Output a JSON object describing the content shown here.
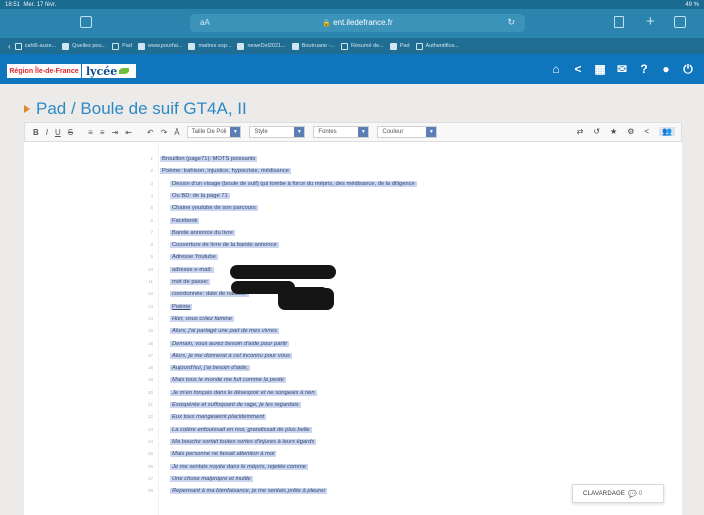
{
  "statusbar": {
    "time": "18:51",
    "date": "Mer. 17 févr.",
    "battery": "49 %"
  },
  "browser": {
    "aa": "aA",
    "url": "ent.iledefrance.fr",
    "tabs": [
      {
        "label": "cahl6-auze...",
        "filled": false
      },
      {
        "label": "Quelles pou...",
        "filled": true
      },
      {
        "label": "Pad",
        "filled": false
      },
      {
        "label": "www.pourfai...",
        "filled": true
      },
      {
        "label": "maitres esp...",
        "filled": true
      },
      {
        "label": "neweDel2021...",
        "filled": true
      },
      {
        "label": "Boutruane -...",
        "filled": true
      },
      {
        "label": "Résumé de...",
        "filled": false
      },
      {
        "label": "Pad",
        "filled": true
      },
      {
        "label": "Authentifica...",
        "filled": false
      }
    ]
  },
  "header": {
    "region_logo": "Région Île-de-France",
    "lycee_logo": "lycée",
    "icons": [
      "home-icon",
      "share-icon",
      "apps-grid-icon",
      "messages-icon",
      "help-icon",
      "user-icon",
      "power-icon"
    ]
  },
  "page": {
    "title": "Pad / Boule de suif GT4A, II"
  },
  "toolbar": {
    "bold": "B",
    "italic": "I",
    "underline": "U",
    "strike": "S",
    "list_ol": "≡",
    "list_ul": "≡",
    "indent": "⇥",
    "outdent": "⇤",
    "undo": "↶",
    "redo": "↷",
    "clear": "Ā",
    "font_size": "Taille De Poli",
    "style": "Style",
    "fonts": "Fontes",
    "color": "Couleur"
  },
  "editor": {
    "lines": [
      {
        "n": "1",
        "text": "Brouillon (page71): MOTS poissants",
        "style": ""
      },
      {
        "n": "2",
        "text": "Poème: trahison, injustice, hypocrisie, médisance",
        "style": ""
      },
      {
        "n": "3",
        "text": "Dessin d'un visage (boule de suif) qui tombe à force du mépris, des médisance, de la diligence",
        "style": ""
      },
      {
        "n": "4",
        "text": "Ou BD: de la page 71",
        "style": ""
      },
      {
        "n": "5",
        "text": "Chaine youtube de son parcours",
        "style": ""
      },
      {
        "n": "6",
        "text": "Facebook",
        "style": ""
      },
      {
        "n": "7",
        "text": "Bande annonce du livre",
        "style": ""
      },
      {
        "n": "8",
        "text": "Couverture de livre de la bande annonce",
        "style": ""
      },
      {
        "n": "9",
        "text": "Adresse Youtube",
        "style": ""
      },
      {
        "n": "10",
        "text": "adresse e-mail:",
        "style": ""
      },
      {
        "n": "11",
        "text": "mot de passe:",
        "style": ""
      },
      {
        "n": "12",
        "text": "coordonnée: date de naissan",
        "style": ""
      },
      {
        "n": "13",
        "text": "Poème",
        "style": "ul"
      },
      {
        "n": "14",
        "text": "Hier, vous criiez famine",
        "style": "it"
      },
      {
        "n": "15",
        "text": "Alors, j'ai partagé une part de mes vivres",
        "style": "it"
      },
      {
        "n": "16",
        "text": "Demain, vous aurez besoin d'aide pour partir",
        "style": "it"
      },
      {
        "n": "17",
        "text": "Alors, je me donnerai à cet inconnu pour vous",
        "style": "it"
      },
      {
        "n": "18",
        "text": "Aujourd'hui, j'ai besoin d'aide,",
        "style": "it"
      },
      {
        "n": "19",
        "text": "Mais tous le monde me fuit comme la peste",
        "style": "it"
      },
      {
        "n": "20",
        "text": "Je m'en fonçais dans le désespoir et ne songeais à rien",
        "style": "it"
      },
      {
        "n": "21",
        "text": "Exaspérée et suffoquant de rage, je les regardais",
        "style": "it"
      },
      {
        "n": "22",
        "text": "Eux tous mangeaient placidemment",
        "style": "it"
      },
      {
        "n": "23",
        "text": "La colère enfouissait en moi, grandissait de plus belle",
        "style": "it"
      },
      {
        "n": "24",
        "text": "Ma bouche sortait toutes sortes d'injures à leurs égards",
        "style": "it"
      },
      {
        "n": "25",
        "text": "Mais personne ne faisait attention à moi",
        "style": "it"
      },
      {
        "n": "26",
        "text": "Je me sentais noyée dans le mépris, rejetée comme",
        "style": "it"
      },
      {
        "n": "27",
        "text": "Une chose malpropre et inutile",
        "style": "it"
      },
      {
        "n": "28",
        "text": "Repensant à ma bienfaisance, je me sentais prête à pleurer",
        "style": "it"
      }
    ]
  },
  "chat": {
    "label": "CLAVARDAGE",
    "count": "0"
  }
}
